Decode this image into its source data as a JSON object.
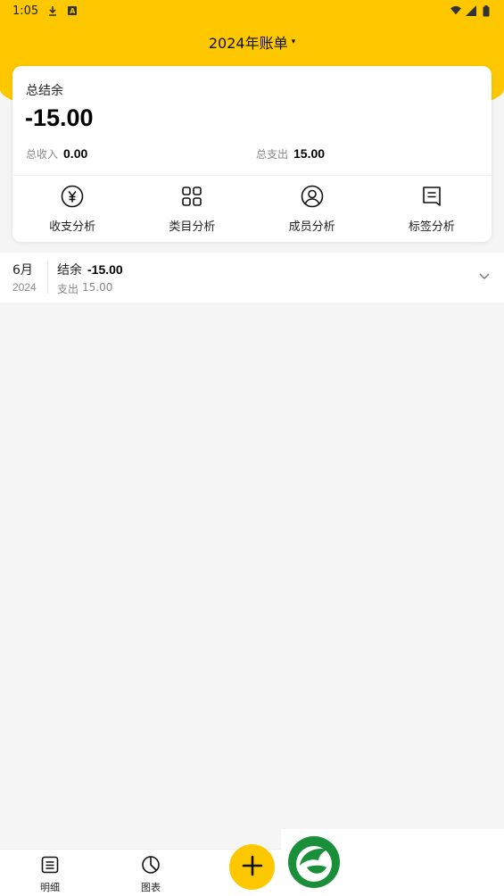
{
  "status": {
    "time": "1:05"
  },
  "header": {
    "title": "2024年账单",
    "caret": "▾"
  },
  "summary": {
    "balance_label": "总结余",
    "balance_value": "-15.00",
    "income_label": "总收入",
    "income_value": "0.00",
    "expense_label": "总支出",
    "expense_value": "15.00"
  },
  "actions": [
    {
      "label": "收支分析",
      "icon": "yen-circle-icon"
    },
    {
      "label": "类目分析",
      "icon": "grid-icon"
    },
    {
      "label": "成员分析",
      "icon": "user-circle-icon"
    },
    {
      "label": "标签分析",
      "icon": "tag-icon"
    }
  ],
  "months": [
    {
      "month": "6月",
      "year": "2024",
      "balance_label": "结余",
      "balance_value": "-15.00",
      "expense_label": "支出",
      "expense_value": "15.00"
    }
  ],
  "bottom_nav": {
    "items": [
      {
        "label": "明细",
        "icon": "list-icon"
      },
      {
        "label": "图表",
        "icon": "pie-chart-icon"
      }
    ],
    "add_icon": "plus-icon"
  },
  "colors": {
    "accent": "#fdc800",
    "background": "#f5f5f5",
    "logo_green": "#1a8f3a"
  }
}
